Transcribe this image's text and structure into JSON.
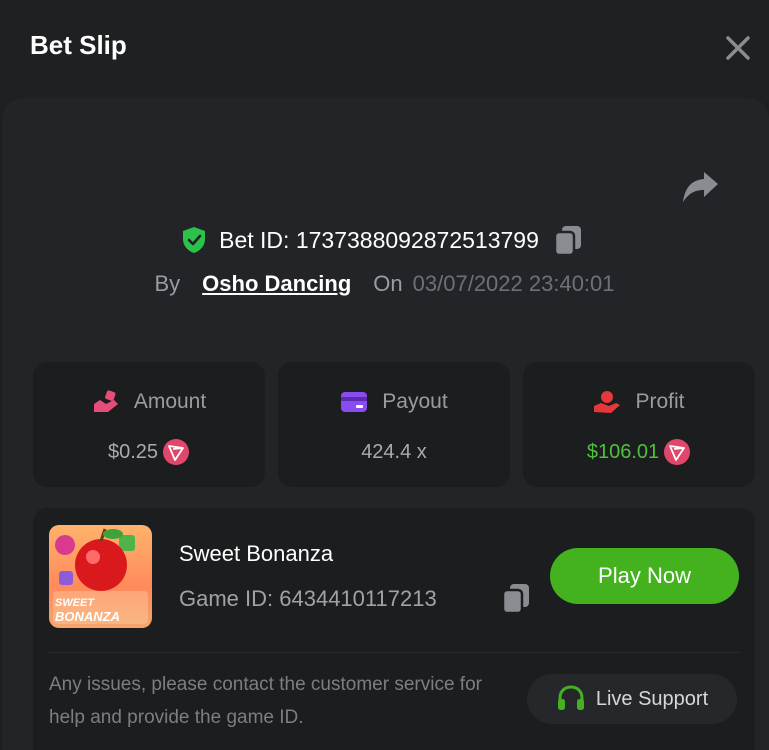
{
  "modal": {
    "title": "Bet Slip"
  },
  "bet": {
    "id_label": "Bet ID: 1737388092872513799",
    "by_label": "By",
    "username": "Osho Dancing",
    "on_label": "On",
    "date": "03/07/2022 23:40:01"
  },
  "stats": {
    "amount": {
      "label": "Amount",
      "value": "$0.25",
      "icon": "wallet-hand-icon",
      "coin": "tron-coin-icon"
    },
    "payout": {
      "label": "Payout",
      "value": "424.4 x",
      "icon": "card-icon"
    },
    "profit": {
      "label": "Profit",
      "value": "$106.01",
      "icon": "profit-hand-icon",
      "coin": "tron-coin-icon"
    }
  },
  "game": {
    "name": "Sweet Bonanza",
    "id_label": "Game ID: 6434410117213",
    "thumb_text_1": "SWEET",
    "thumb_text_2": "BONANZA",
    "play_label": "Play Now"
  },
  "support": {
    "notice": "Any issues, please contact the customer service for help and provide the game ID.",
    "button_label": "Live Support"
  },
  "colors": {
    "accent_green": "#43b21e",
    "profit_green": "#4fc13a",
    "shield_green": "#2bc14a",
    "amount_pink": "#e84d7a",
    "payout_purple": "#8a4bf0",
    "profit_red": "#e5383b",
    "coin_red": "#e0476a"
  }
}
